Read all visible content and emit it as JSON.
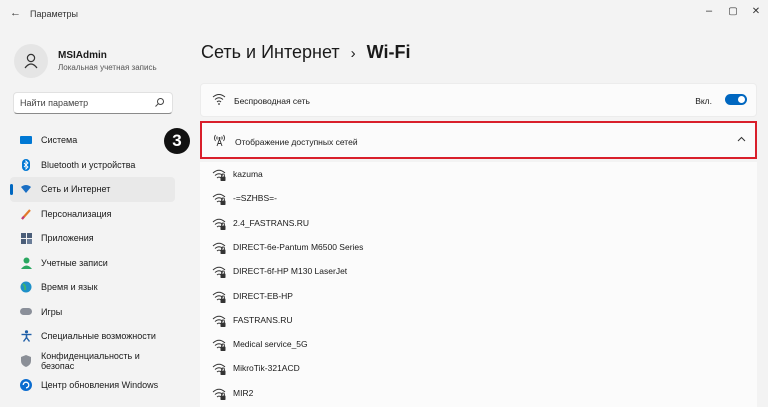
{
  "window": {
    "title": "Параметры",
    "back_glyph": "←",
    "minimize_glyph": "–",
    "maximize_glyph": "▢",
    "close_glyph": "✕"
  },
  "profile": {
    "name": "MSIAdmin",
    "account_type": "Локальная учетная запись"
  },
  "search": {
    "placeholder": "Найти параметр"
  },
  "sidebar": {
    "items": [
      {
        "label": "Система",
        "icon": "monitor-icon",
        "active": false
      },
      {
        "label": "Bluetooth и устройства",
        "icon": "bluetooth-icon",
        "active": false
      },
      {
        "label": "Сеть и Интернет",
        "icon": "wifi-icon",
        "active": true
      },
      {
        "label": "Персонализация",
        "icon": "brush-icon",
        "active": false
      },
      {
        "label": "Приложения",
        "icon": "apps-icon",
        "active": false
      },
      {
        "label": "Учетные записи",
        "icon": "person-icon",
        "active": false
      },
      {
        "label": "Время и язык",
        "icon": "globe-icon",
        "active": false
      },
      {
        "label": "Игры",
        "icon": "gamepad-icon",
        "active": false
      },
      {
        "label": "Специальные возможности",
        "icon": "accessibility-icon",
        "active": false
      },
      {
        "label": "Конфиденциальность и безопас",
        "icon": "shield-icon",
        "active": false
      },
      {
        "label": "Центр обновления Windows",
        "icon": "update-icon",
        "active": false
      }
    ]
  },
  "header": {
    "section": "Сеть и Интернет",
    "separator": "›",
    "page": "Wi-Fi"
  },
  "wireless": {
    "label": "Беспроводная сеть",
    "state_label": "Вкл.",
    "enabled": true
  },
  "available": {
    "label": "Отображение доступных сетей",
    "expanded": true,
    "step_number": "3"
  },
  "networks": [
    "kazuma",
    "-=SZHBS=-",
    "2.4_FASTRANS.RU",
    "DIRECT-6e-Pantum M6500 Series",
    "DIRECT-6f-HP M130 LaserJet",
    "DIRECT-EB-HP",
    "FASTRANS.RU",
    "Medical service_5G",
    "MikroTik-321ACD",
    "MIR2"
  ],
  "colors": {
    "accent": "#0067c0",
    "highlight": "#d91f2b"
  }
}
